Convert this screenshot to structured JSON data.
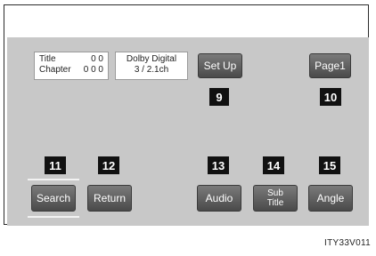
{
  "info": {
    "title_label": "Title",
    "title_value": "0 0",
    "chapter_label": "Chapter",
    "chapter_value": "0 0 0",
    "audio_format": "Dolby Digital",
    "audio_channels": "3 / 2.1ch"
  },
  "buttons": {
    "setup": "Set Up",
    "page": "Page1",
    "search": "Search",
    "return": "Return",
    "audio": "Audio",
    "subtitle_line1": "Sub",
    "subtitle_line2": "Title",
    "angle": "Angle"
  },
  "callouts": {
    "n9": "9",
    "n10": "10",
    "n11": "11",
    "n12": "12",
    "n13": "13",
    "n14": "14",
    "n15": "15"
  },
  "caption": "ITY33V011"
}
